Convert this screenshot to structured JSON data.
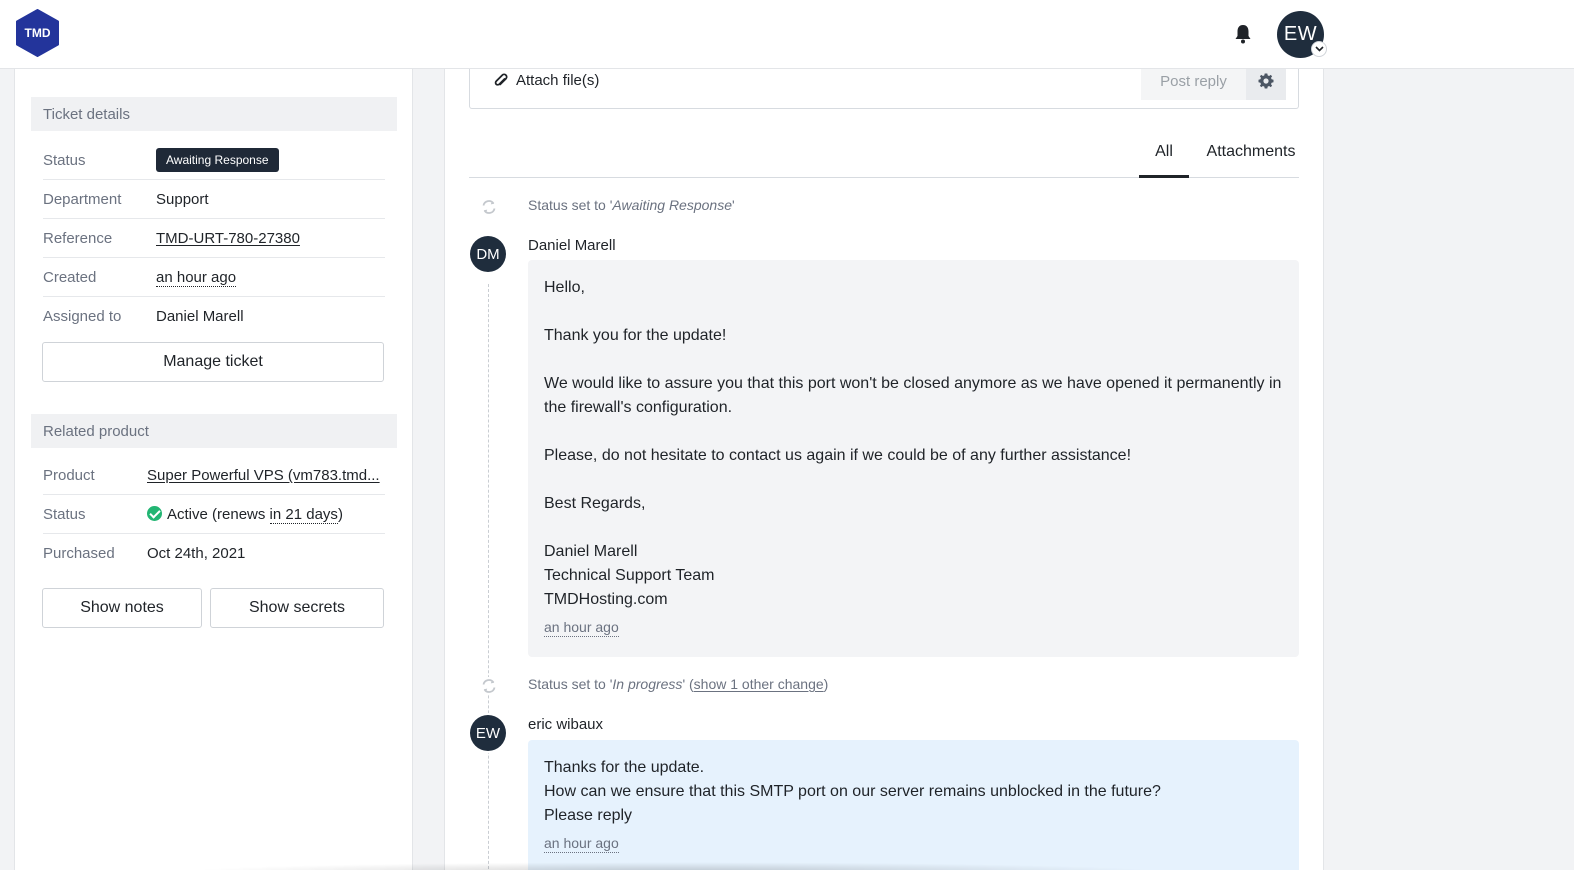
{
  "header": {
    "logo_text": "TMD",
    "user_initials": "EW",
    "bell_icon": "bell-icon"
  },
  "ticket_details": {
    "title": "Ticket details",
    "status_label": "Status",
    "status_value": "Awaiting Response",
    "department_label": "Department",
    "department_value": "Support",
    "reference_label": "Reference",
    "reference_value": "TMD-URT-780-27380",
    "created_label": "Created",
    "created_value": "an hour ago",
    "assigned_label": "Assigned to",
    "assigned_value": "Daniel Marell",
    "manage_button": "Manage ticket"
  },
  "related_product": {
    "title": "Related product",
    "product_label": "Product",
    "product_value": "Super Powerful VPS (vm783.tmd...",
    "status_label": "Status",
    "status_prefix": "Active (renews ",
    "status_renews": "in 21 days",
    "status_suffix": ")",
    "purchased_label": "Purchased",
    "purchased_value": "Oct 24th, 2021",
    "show_notes": "Show notes",
    "show_secrets": "Show secrets"
  },
  "reply": {
    "attach_label": "Attach file(s)",
    "post_label": "Post reply"
  },
  "tabs": [
    {
      "label": "All",
      "active": true
    },
    {
      "label": "Attachments",
      "active": false
    }
  ],
  "timeline": {
    "event1_prefix": "Status set to '",
    "event1_status": "Awaiting Response",
    "event1_suffix": "'",
    "msg1": {
      "initials": "DM",
      "author": "Daniel Marell",
      "line1": "Hello,",
      "line2": "Thank you for the update!",
      "line3": "We would like to assure you that this port won't be closed anymore as we have opened it permanently in the firewall's configuration.",
      "line4": "Please, do not hesitate to contact us again if we could be of any further assistance!",
      "line5": "Best Regards,",
      "sig1": "Daniel Marell",
      "sig2": "Technical Support Team",
      "sig3": "TMDHosting.com",
      "time": "an hour ago"
    },
    "event2_prefix": "Status set to '",
    "event2_status": "In progress",
    "event2_mid": "' (",
    "event2_link": "show 1 other change",
    "event2_suffix": ")",
    "msg2": {
      "initials": "EW",
      "author": "eric wibaux",
      "line1": "Thanks for the update.",
      "line2": "How can we ensure that this SMTP port on our server remains unblocked in the future?",
      "line3": "Please reply",
      "time": "an hour ago"
    }
  },
  "colors": {
    "logo": "#23349b",
    "dark": "#1f2d3d",
    "success": "#22b573",
    "message_grey": "#f3f4f6",
    "message_blue": "#e6f2fd"
  }
}
